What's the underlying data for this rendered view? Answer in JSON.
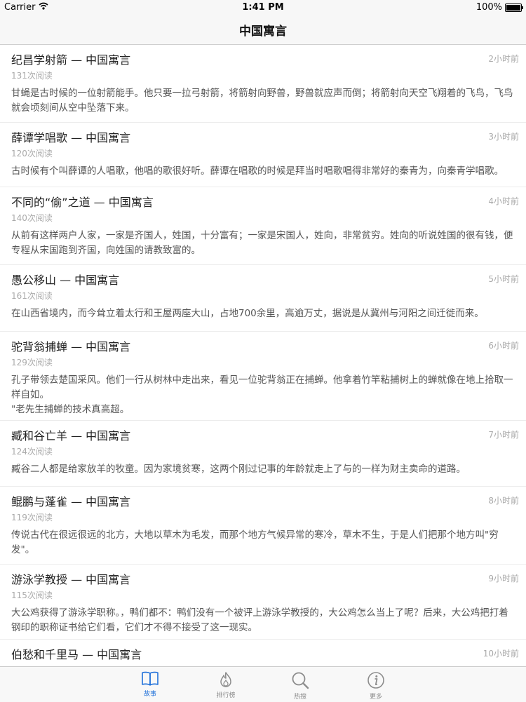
{
  "status_bar": {
    "carrier": "Carrier",
    "time": "1:41 PM",
    "battery": "100%",
    "icons": [
      "wifi-icon",
      "battery-icon"
    ]
  },
  "nav": {
    "title": "中国寓言"
  },
  "stories": [
    {
      "title": "纪昌学射箭 — 中国寓言",
      "time": "2小时前",
      "reads": "131次阅读",
      "summary": "甘蝇是古时候的一位射箭能手。他只要一拉弓射箭，将箭射向野兽，野兽就应声而倒；将箭射向天空飞翔着的飞鸟，飞鸟就会顷刻间从空中坠落下来。"
    },
    {
      "title": "薛谭学唱歌 — 中国寓言",
      "time": "3小时前",
      "reads": "120次阅读",
      "summary": "古时候有个叫薛谭的人唱歌，他唱的歌很好听。薛谭在唱歌的时候是拜当时唱歌唱得非常好的秦青为，向秦青学唱歌。"
    },
    {
      "title": "不同的“偷”之道 — 中国寓言",
      "time": "4小时前",
      "reads": "140次阅读",
      "summary": "从前有这样两户人家，一家是齐国人，姓国，十分富有；一家是宋国人，姓向，非常贫穷。姓向的听说姓国的很有钱，便专程从宋国跑到齐国，向姓国的请教致富的。"
    },
    {
      "title": "愚公移山 — 中国寓言",
      "time": "5小时前",
      "reads": "161次阅读",
      "summary": "在山西省境内，而今耸立着太行和王屋两座大山，占地700余里，高逾万丈，据说是从冀州与河阳之间迁徙而来。"
    },
    {
      "title": "驼背翁捕蝉 — 中国寓言",
      "time": "6小时前",
      "reads": "129次阅读",
      "summary": "孔子带领去楚国采风。他们一行从树林中走出来，看见一位驼背翁正在捕蝉。他拿着竹竿粘捕树上的蝉就像在地上拾取一样自如。\n\"老先生捕蝉的技术真高超。"
    },
    {
      "title": "臧和谷亡羊 — 中国寓言",
      "time": "7小时前",
      "reads": "124次阅读",
      "summary": "臧谷二人都是给家放羊的牧童。因为家境贫寒，这两个刚过记事的年龄就走上了与的一样为财主卖命的道路。"
    },
    {
      "title": "鲲鹏与蓬雀 — 中国寓言",
      "time": "8小时前",
      "reads": "119次阅读",
      "summary": "传说古代在很远很远的北方，大地以草木为毛发，而那个地方气候异常的寒冷，草木不生，于是人们把那个地方叫\"穷发\"。"
    },
    {
      "title": "游泳学教授 — 中国寓言",
      "time": "9小时前",
      "reads": "115次阅读",
      "summary": "大公鸡获得了游泳学职称。，鸭们都不：鸭们没有一个被评上游泳学教授的，大公鸡怎么当上了呢？后来，大公鸡把打着钢印的职称证书给它们看，它们才不得不接受了这一现实。"
    },
    {
      "title": "伯愁和千里马 — 中国寓言",
      "time": "10小时前",
      "reads": "",
      "summary": ""
    }
  ],
  "tabs": [
    {
      "label": "故事",
      "icon": "book-icon",
      "active": true,
      "active_color": "#1e6fd9"
    },
    {
      "label": "排行榜",
      "icon": "flame-icon",
      "active": false
    },
    {
      "label": "热搜",
      "icon": "search-icon",
      "active": false
    },
    {
      "label": "更多",
      "icon": "info-icon",
      "active": false
    }
  ]
}
